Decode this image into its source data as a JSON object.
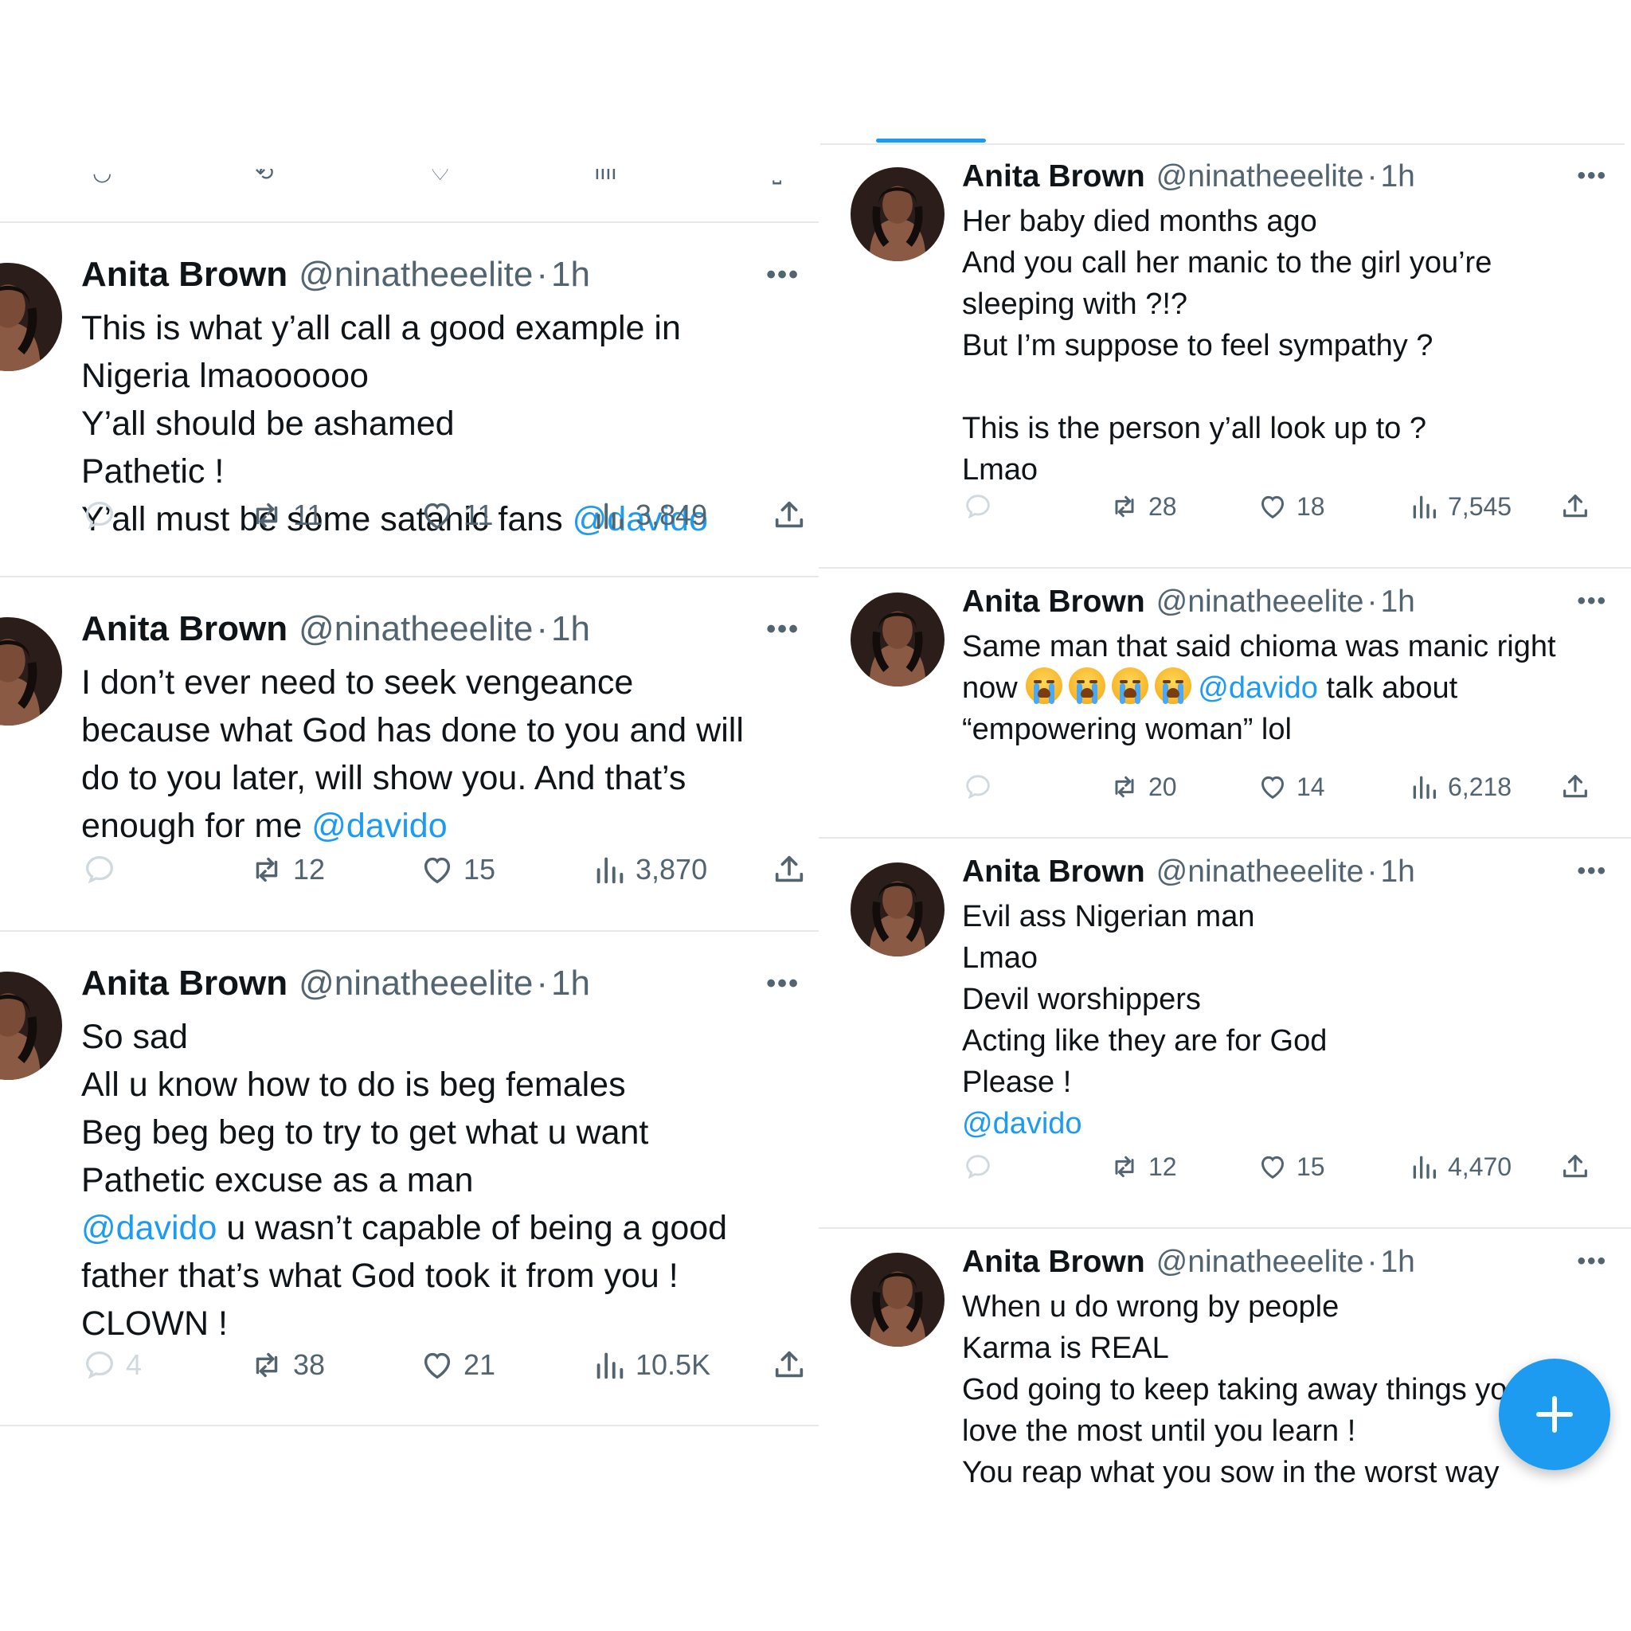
{
  "colors": {
    "accent": "#1d9bf0",
    "muted": "#536471",
    "text": "#0f1419",
    "divider": "#e6e8ea"
  },
  "left_tweets": [
    {
      "name": "Anita Brown",
      "handle": "@ninatheeelite",
      "separator": "·",
      "time": "1h",
      "lines": [
        {
          "text": "This is what y’all call a good example in"
        },
        {
          "text": "Nigeria lmaoooooo"
        },
        {
          "text": "Y’all should be ashamed"
        },
        {
          "text": "Pathetic !"
        },
        {
          "text": "Y’all must be some satanic fans ",
          "mention": "@davido"
        }
      ],
      "replies": "",
      "reposts": "11",
      "likes": "11",
      "views": "3,849"
    },
    {
      "name": "Anita Brown",
      "handle": "@ninatheeelite",
      "separator": "·",
      "time": "1h",
      "lines": [
        {
          "text": "I don’t ever need to seek vengeance"
        },
        {
          "text": "because what God has done to you and will"
        },
        {
          "text": "do to you later, will show you. And that’s"
        },
        {
          "text": "enough for me ",
          "mention": "@davido"
        }
      ],
      "replies": "",
      "reposts": "12",
      "likes": "15",
      "views": "3,870"
    },
    {
      "name": "Anita Brown",
      "handle": "@ninatheeelite",
      "separator": "·",
      "time": "1h",
      "lines": [
        {
          "text": "So sad"
        },
        {
          "text": "All u know how to do is beg females"
        },
        {
          "text": "Beg beg beg to try to get what u want"
        },
        {
          "text": "Pathetic excuse as a man"
        },
        {
          "mention": "@davido",
          "text_after": " u wasn’t capable of being a good"
        },
        {
          "text": "father that’s what God took it from you !"
        },
        {
          "text": "CLOWN !"
        }
      ],
      "replies": "4",
      "reposts": "38",
      "likes": "21",
      "views": "10.5K"
    }
  ],
  "right_tweets": [
    {
      "name": "Anita Brown",
      "handle": "@ninatheeelite",
      "separator": "·",
      "time": "1h",
      "lines": [
        {
          "text": "Her baby died months ago"
        },
        {
          "text": "And you call her manic to the girl you’re"
        },
        {
          "text": "sleeping with ?!?"
        },
        {
          "text": "But I’m suppose to feel sympathy ?"
        },
        {
          "blank": true
        },
        {
          "text": "This is the person y’all look up to ?"
        },
        {
          "text": "Lmao"
        }
      ],
      "replies": "",
      "reposts": "28",
      "likes": "18",
      "views": "7,545"
    },
    {
      "name": "Anita Brown",
      "handle": "@ninatheeelite",
      "separator": "·",
      "time": "1h",
      "lines": [
        {
          "text": "Same man that said chioma was manic right"
        },
        {
          "text": "now ",
          "emoji_count": 4,
          "mention": "@davido",
          "text_after": " talk about"
        },
        {
          "text": "“empowering woman” lol"
        }
      ],
      "replies": "",
      "reposts": "20",
      "likes": "14",
      "views": "6,218"
    },
    {
      "name": "Anita Brown",
      "handle": "@ninatheeelite",
      "separator": "·",
      "time": "1h",
      "lines": [
        {
          "text": "Evil ass Nigerian man"
        },
        {
          "text": "Lmao"
        },
        {
          "text": "Devil worshippers"
        },
        {
          "text": "Acting like they are for God"
        },
        {
          "text": "Please !"
        },
        {
          "mention": "@davido"
        }
      ],
      "replies": "",
      "reposts": "12",
      "likes": "15",
      "views": "4,470"
    },
    {
      "name": "Anita Brown",
      "handle": "@ninatheeelite",
      "separator": "·",
      "time": "1h",
      "lines": [
        {
          "text": "When u do wrong by people"
        },
        {
          "text": "Karma is REAL"
        },
        {
          "text": "God going to keep taking away things you"
        },
        {
          "text": "love the most until you learn !"
        },
        {
          "text": "You reap what you sow in the worst way"
        }
      ]
    }
  ],
  "fab": {
    "icon": "plus-icon"
  }
}
